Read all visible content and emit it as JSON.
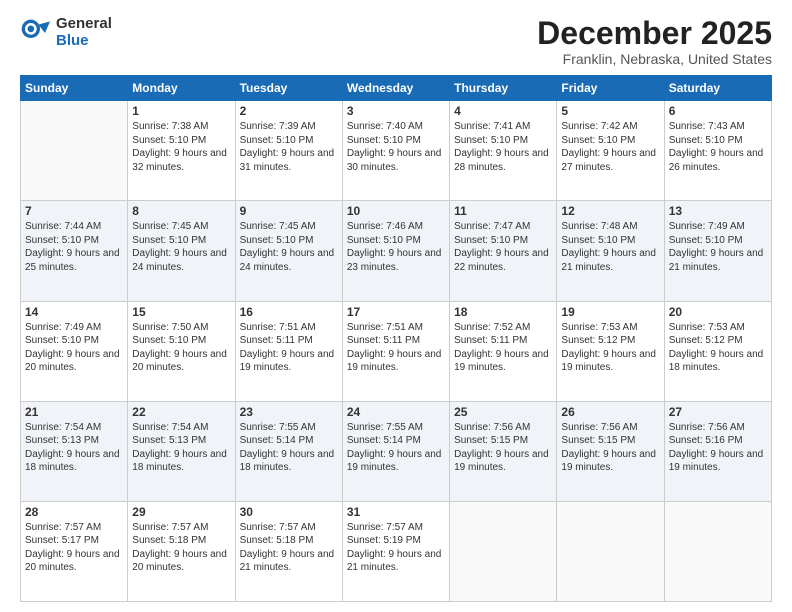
{
  "header": {
    "logo_general": "General",
    "logo_blue": "Blue",
    "month_title": "December 2025",
    "location": "Franklin, Nebraska, United States"
  },
  "days_of_week": [
    "Sunday",
    "Monday",
    "Tuesday",
    "Wednesday",
    "Thursday",
    "Friday",
    "Saturday"
  ],
  "weeks": [
    [
      {
        "num": "",
        "empty": true
      },
      {
        "num": "1",
        "sunrise": "7:38 AM",
        "sunset": "5:10 PM",
        "daylight": "9 hours and 32 minutes."
      },
      {
        "num": "2",
        "sunrise": "7:39 AM",
        "sunset": "5:10 PM",
        "daylight": "9 hours and 31 minutes."
      },
      {
        "num": "3",
        "sunrise": "7:40 AM",
        "sunset": "5:10 PM",
        "daylight": "9 hours and 30 minutes."
      },
      {
        "num": "4",
        "sunrise": "7:41 AM",
        "sunset": "5:10 PM",
        "daylight": "9 hours and 28 minutes."
      },
      {
        "num": "5",
        "sunrise": "7:42 AM",
        "sunset": "5:10 PM",
        "daylight": "9 hours and 27 minutes."
      },
      {
        "num": "6",
        "sunrise": "7:43 AM",
        "sunset": "5:10 PM",
        "daylight": "9 hours and 26 minutes."
      }
    ],
    [
      {
        "num": "7",
        "sunrise": "7:44 AM",
        "sunset": "5:10 PM",
        "daylight": "9 hours and 25 minutes."
      },
      {
        "num": "8",
        "sunrise": "7:45 AM",
        "sunset": "5:10 PM",
        "daylight": "9 hours and 24 minutes."
      },
      {
        "num": "9",
        "sunrise": "7:45 AM",
        "sunset": "5:10 PM",
        "daylight": "9 hours and 24 minutes."
      },
      {
        "num": "10",
        "sunrise": "7:46 AM",
        "sunset": "5:10 PM",
        "daylight": "9 hours and 23 minutes."
      },
      {
        "num": "11",
        "sunrise": "7:47 AM",
        "sunset": "5:10 PM",
        "daylight": "9 hours and 22 minutes."
      },
      {
        "num": "12",
        "sunrise": "7:48 AM",
        "sunset": "5:10 PM",
        "daylight": "9 hours and 21 minutes."
      },
      {
        "num": "13",
        "sunrise": "7:49 AM",
        "sunset": "5:10 PM",
        "daylight": "9 hours and 21 minutes."
      }
    ],
    [
      {
        "num": "14",
        "sunrise": "7:49 AM",
        "sunset": "5:10 PM",
        "daylight": "9 hours and 20 minutes."
      },
      {
        "num": "15",
        "sunrise": "7:50 AM",
        "sunset": "5:10 PM",
        "daylight": "9 hours and 20 minutes."
      },
      {
        "num": "16",
        "sunrise": "7:51 AM",
        "sunset": "5:11 PM",
        "daylight": "9 hours and 19 minutes."
      },
      {
        "num": "17",
        "sunrise": "7:51 AM",
        "sunset": "5:11 PM",
        "daylight": "9 hours and 19 minutes."
      },
      {
        "num": "18",
        "sunrise": "7:52 AM",
        "sunset": "5:11 PM",
        "daylight": "9 hours and 19 minutes."
      },
      {
        "num": "19",
        "sunrise": "7:53 AM",
        "sunset": "5:12 PM",
        "daylight": "9 hours and 19 minutes."
      },
      {
        "num": "20",
        "sunrise": "7:53 AM",
        "sunset": "5:12 PM",
        "daylight": "9 hours and 18 minutes."
      }
    ],
    [
      {
        "num": "21",
        "sunrise": "7:54 AM",
        "sunset": "5:13 PM",
        "daylight": "9 hours and 18 minutes."
      },
      {
        "num": "22",
        "sunrise": "7:54 AM",
        "sunset": "5:13 PM",
        "daylight": "9 hours and 18 minutes."
      },
      {
        "num": "23",
        "sunrise": "7:55 AM",
        "sunset": "5:14 PM",
        "daylight": "9 hours and 18 minutes."
      },
      {
        "num": "24",
        "sunrise": "7:55 AM",
        "sunset": "5:14 PM",
        "daylight": "9 hours and 19 minutes."
      },
      {
        "num": "25",
        "sunrise": "7:56 AM",
        "sunset": "5:15 PM",
        "daylight": "9 hours and 19 minutes."
      },
      {
        "num": "26",
        "sunrise": "7:56 AM",
        "sunset": "5:15 PM",
        "daylight": "9 hours and 19 minutes."
      },
      {
        "num": "27",
        "sunrise": "7:56 AM",
        "sunset": "5:16 PM",
        "daylight": "9 hours and 19 minutes."
      }
    ],
    [
      {
        "num": "28",
        "sunrise": "7:57 AM",
        "sunset": "5:17 PM",
        "daylight": "9 hours and 20 minutes."
      },
      {
        "num": "29",
        "sunrise": "7:57 AM",
        "sunset": "5:18 PM",
        "daylight": "9 hours and 20 minutes."
      },
      {
        "num": "30",
        "sunrise": "7:57 AM",
        "sunset": "5:18 PM",
        "daylight": "9 hours and 21 minutes."
      },
      {
        "num": "31",
        "sunrise": "7:57 AM",
        "sunset": "5:19 PM",
        "daylight": "9 hours and 21 minutes."
      },
      {
        "num": "",
        "empty": true
      },
      {
        "num": "",
        "empty": true
      },
      {
        "num": "",
        "empty": true
      }
    ]
  ],
  "labels": {
    "sunrise": "Sunrise:",
    "sunset": "Sunset:",
    "daylight": "Daylight:"
  }
}
